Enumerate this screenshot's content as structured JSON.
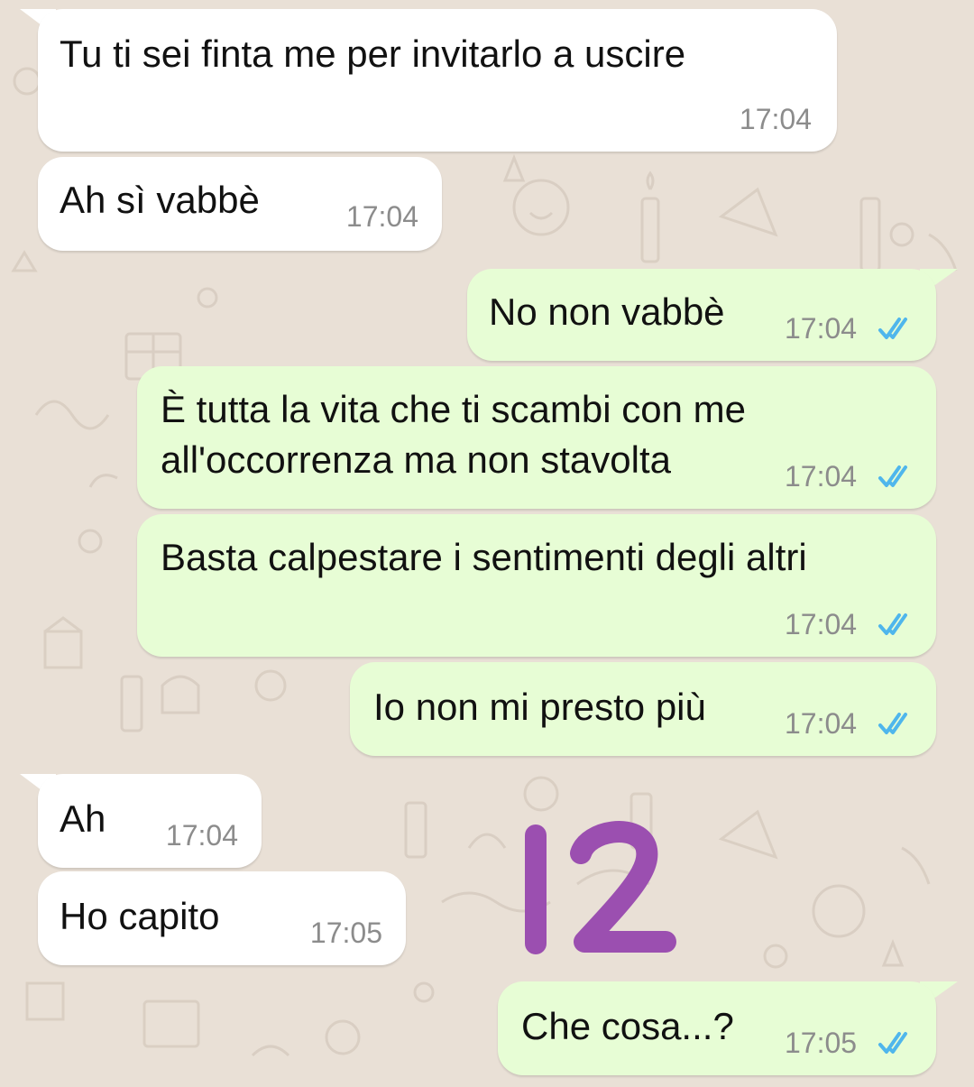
{
  "chat": {
    "messages": [
      {
        "id": "m1",
        "direction": "incoming",
        "text": "Tu ti sei finta me per invitarlo a uscire",
        "time": "17:04"
      },
      {
        "id": "m2",
        "direction": "incoming",
        "text": "Ah sì vabbè",
        "time": "17:04"
      },
      {
        "id": "m3",
        "direction": "outgoing",
        "text": "No non vabbè",
        "time": "17:04",
        "status": "read"
      },
      {
        "id": "m4",
        "direction": "outgoing",
        "line1": "È tutta la vita che ti scambi con me",
        "line2": "all'occorrenza ma non stavolta",
        "time": "17:04",
        "status": "read"
      },
      {
        "id": "m5",
        "direction": "outgoing",
        "text": "Basta calpestare i sentimenti degli altri",
        "time": "17:04",
        "status": "read"
      },
      {
        "id": "m6",
        "direction": "outgoing",
        "text": "Io non mi presto più",
        "time": "17:04",
        "status": "read"
      },
      {
        "id": "m7",
        "direction": "incoming",
        "text": "Ah",
        "time": "17:04"
      },
      {
        "id": "m8",
        "direction": "incoming",
        "text": "Ho capito",
        "time": "17:05"
      },
      {
        "id": "m9",
        "direction": "outgoing",
        "text": "Che cosa...?",
        "time": "17:05",
        "status": "read"
      }
    ]
  },
  "overlay": {
    "handwritten_number": "12",
    "color": "#9b4fb0"
  },
  "colors": {
    "incoming_bubble": "#ffffff",
    "outgoing_bubble": "#e7fdd5",
    "read_ticks": "#4fb6ec",
    "wallpaper": "#e9e0d6"
  },
  "icons": {
    "read_receipt": "double-check-icon"
  }
}
